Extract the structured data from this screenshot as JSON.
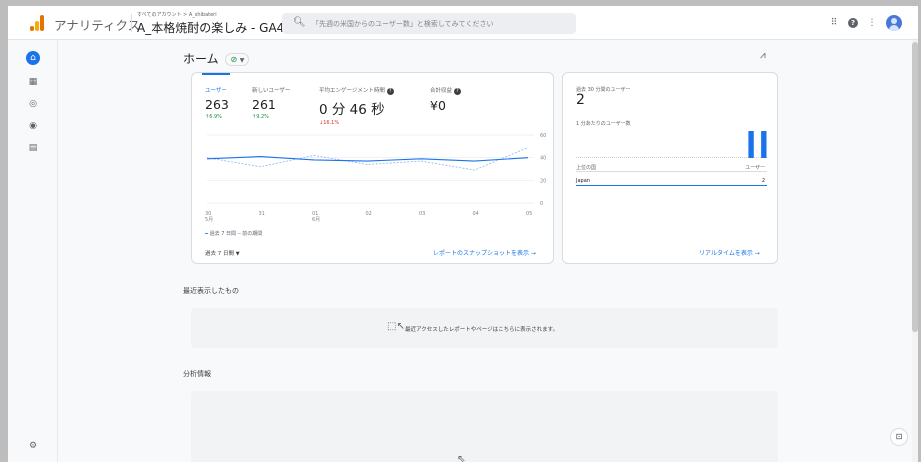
{
  "header": {
    "app_name": "アナリティクス",
    "breadcrumb": "すべてのアカウント > A_shibateri",
    "property": "A_本格焼酎の楽しみ - GA4",
    "search_placeholder": "「先週の米国からのユーザー数」と検索してみてください",
    "icons": [
      "apps-grid-icon",
      "help-icon",
      "more-vert-icon",
      "account-avatar"
    ]
  },
  "rail": [
    "home-icon",
    "reports-icon",
    "explore-icon",
    "advertising-icon",
    "configure-icon",
    "admin-gear-icon"
  ],
  "page": {
    "title": "ホーム",
    "status_symbol": "⊘"
  },
  "overview": {
    "metrics": [
      {
        "label": "ユーザー",
        "value": "263",
        "delta": "↑6.9%",
        "dir": "up"
      },
      {
        "label": "新しいユーザー",
        "value": "261",
        "delta": "↑9.2%",
        "dir": "up"
      },
      {
        "label": "平均エンゲージメント時間",
        "value": "0 分 46 秒",
        "delta": "↓16.1%",
        "dir": "down"
      },
      {
        "label": "合計収益",
        "value": "¥0",
        "delta": "",
        "dir": ""
      }
    ],
    "legend_current": "過去 7 日間",
    "legend_previous": "前の期間",
    "date_range": "過去 7 日間",
    "snapshot_link": "レポートのスナップショットを表示 →"
  },
  "chart_data": {
    "type": "line",
    "x": [
      "30 5月",
      "31",
      "01 6月",
      "02",
      "03",
      "04",
      "05"
    ],
    "ylim": [
      0,
      60
    ],
    "yticks": [
      0,
      20,
      40,
      60
    ],
    "series": [
      {
        "name": "過去 7 日間",
        "values": [
          39,
          41,
          38,
          37,
          39,
          37,
          40
        ],
        "color": "#1a73e8"
      },
      {
        "name": "前の期間",
        "values": [
          40,
          32,
          42,
          34,
          37,
          29,
          49
        ],
        "color": "#8ab4f8"
      }
    ]
  },
  "realtime": {
    "label": "過去 30 分間のユーザー",
    "value": "2",
    "per_minute_label": "1 分あたりのユーザー数",
    "bars": [
      0,
      0,
      0,
      0,
      0,
      0,
      0,
      0,
      0,
      0,
      0,
      0,
      0,
      0,
      0,
      0,
      0,
      0,
      0,
      0,
      0,
      0,
      0,
      0,
      0,
      0,
      0,
      1,
      0,
      1
    ],
    "table_header_country": "上位の国",
    "table_header_users": "ユーザー",
    "rows": [
      {
        "country": "Japan",
        "users": "2"
      }
    ],
    "link": "リアルタイムを表示 →"
  },
  "recent": {
    "title": "最近表示したもの",
    "message": "最近アクセスしたレポートやページはこちらに表示されます。"
  },
  "insights": {
    "title": "分析情報"
  }
}
